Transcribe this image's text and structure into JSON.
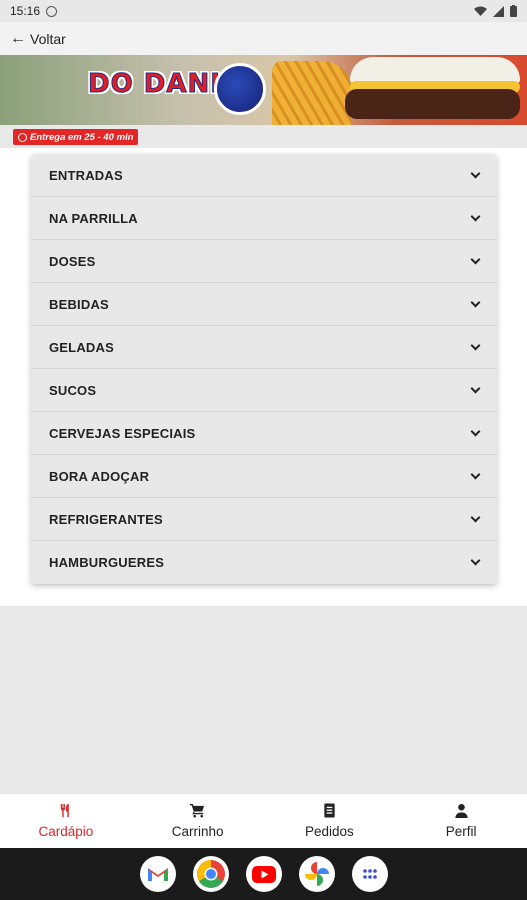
{
  "status_bar": {
    "time": "15:16"
  },
  "topbar": {
    "back_label": "Voltar"
  },
  "banner": {
    "brand": "DO DANI"
  },
  "delivery_badge": {
    "text": "Entrega em 25 - 40 min"
  },
  "menu_categories": [
    "ENTRADAS",
    "NA PARRILLA",
    "DOSES",
    "BEBIDAS",
    "GELADAS",
    "SUCOS",
    "CERVEJAS ESPECIAIS",
    "BORA ADOÇAR",
    "REFRIGERANTES",
    "HAMBURGUERES"
  ],
  "bottom_nav": {
    "items": [
      {
        "label": "Cardápio",
        "icon": "utensils-icon"
      },
      {
        "label": "Carrinho",
        "icon": "cart-icon"
      },
      {
        "label": "Pedidos",
        "icon": "receipt-icon"
      },
      {
        "label": "Perfil",
        "icon": "user-icon"
      }
    ],
    "active_color": "#d62828"
  },
  "dock": {
    "apps": [
      "gmail-icon",
      "chrome-icon",
      "youtube-icon",
      "photos-icon",
      "app-drawer-icon"
    ]
  }
}
